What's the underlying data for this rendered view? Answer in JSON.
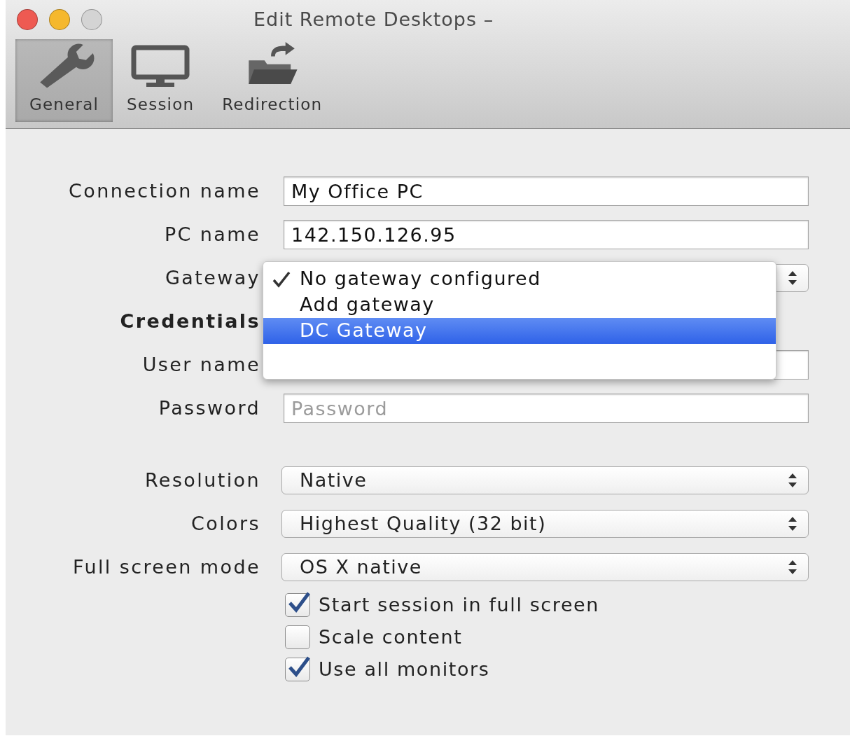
{
  "window": {
    "title": "Edit Remote Desktops –",
    "buttons": [
      {
        "color": "#ee5a52"
      },
      {
        "color": "#f5b82e"
      },
      {
        "color": "#d4d4d4"
      }
    ]
  },
  "toolbar": {
    "tabs": [
      {
        "kind": "wrench",
        "label": "General",
        "selected": true
      },
      {
        "kind": "monitor",
        "label": "Session",
        "selected": false
      },
      {
        "kind": "folder",
        "label": "Redirection",
        "selected": false
      }
    ]
  },
  "form": [
    {
      "kind": "text",
      "label": "Connection name",
      "value": "My Office PC"
    },
    {
      "kind": "text",
      "label": "PC name",
      "value": "142.150.126.95"
    },
    {
      "kind": "select",
      "label": "Gateway",
      "menu": [
        {
          "label": "No gateway configured",
          "checked": true,
          "selected": false
        },
        {
          "label": "Add gateway",
          "checked": false,
          "selected": false
        },
        {
          "label": "DC Gateway",
          "checked": false,
          "selected": true
        }
      ]
    },
    {
      "kind": "heading",
      "label": "Credentials"
    },
    {
      "kind": "text",
      "label": "User name"
    },
    {
      "kind": "text",
      "label": "Password",
      "placeholder": "Password"
    },
    {
      "kind": "spacer"
    },
    {
      "kind": "select",
      "label": "Resolution",
      "value": "Native"
    },
    {
      "kind": "select",
      "label": "Colors",
      "value": "Highest Quality (32 bit)"
    },
    {
      "kind": "select",
      "label": "Full screen mode",
      "value": "OS X native"
    },
    {
      "kind": "checkbox",
      "label": "Start session in full screen",
      "checked": true
    },
    {
      "kind": "checkbox",
      "label": "Scale content",
      "checked": false
    },
    {
      "kind": "checkbox",
      "label": "Use all monitors",
      "checked": true
    }
  ]
}
